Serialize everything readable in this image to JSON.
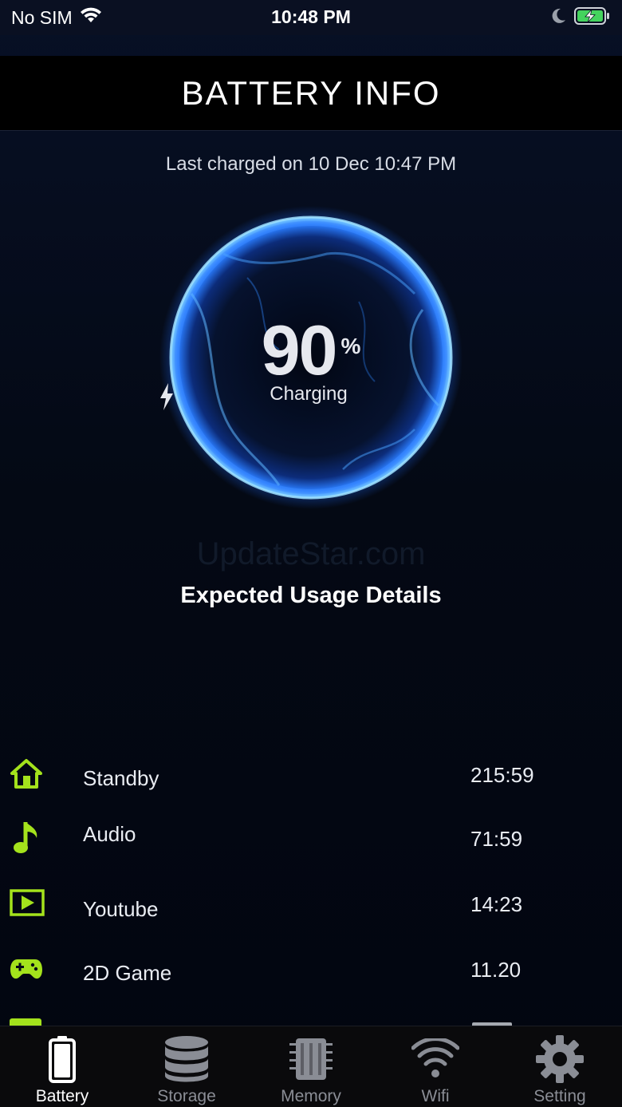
{
  "status_bar": {
    "carrier": "No SIM",
    "time": "10:48 PM",
    "icons": [
      "wifi-icon",
      "moon-icon",
      "battery-charging-icon"
    ]
  },
  "header": {
    "title": "BATTERY INFO"
  },
  "last_charged": "Last charged on 10 Dec 10:47 PM",
  "battery": {
    "level": "90",
    "unit": "%",
    "status": "Charging",
    "orb_color": "#1e6bff"
  },
  "watermark": "UpdateStar.com",
  "usage_title": "Expected Usage Details",
  "usage": [
    {
      "icon": "home-icon",
      "label": "Standby",
      "value": "215:59"
    },
    {
      "icon": "music-note-icon",
      "label": "Audio",
      "value": "71:59"
    },
    {
      "icon": "video-play-icon",
      "label": "Youtube",
      "value": "14:23"
    },
    {
      "icon": "gamepad-icon",
      "label": "2D Game",
      "value": "11.20"
    }
  ],
  "accent_color": "#a4e21c",
  "tabs": [
    {
      "label": "Battery",
      "icon": "battery-icon",
      "active": true
    },
    {
      "label": "Storage",
      "icon": "database-icon",
      "active": false
    },
    {
      "label": "Memory",
      "icon": "chip-icon",
      "active": false
    },
    {
      "label": "Wifi",
      "icon": "wifi-icon",
      "active": false
    },
    {
      "label": "Setting",
      "icon": "gear-icon",
      "active": false
    }
  ]
}
